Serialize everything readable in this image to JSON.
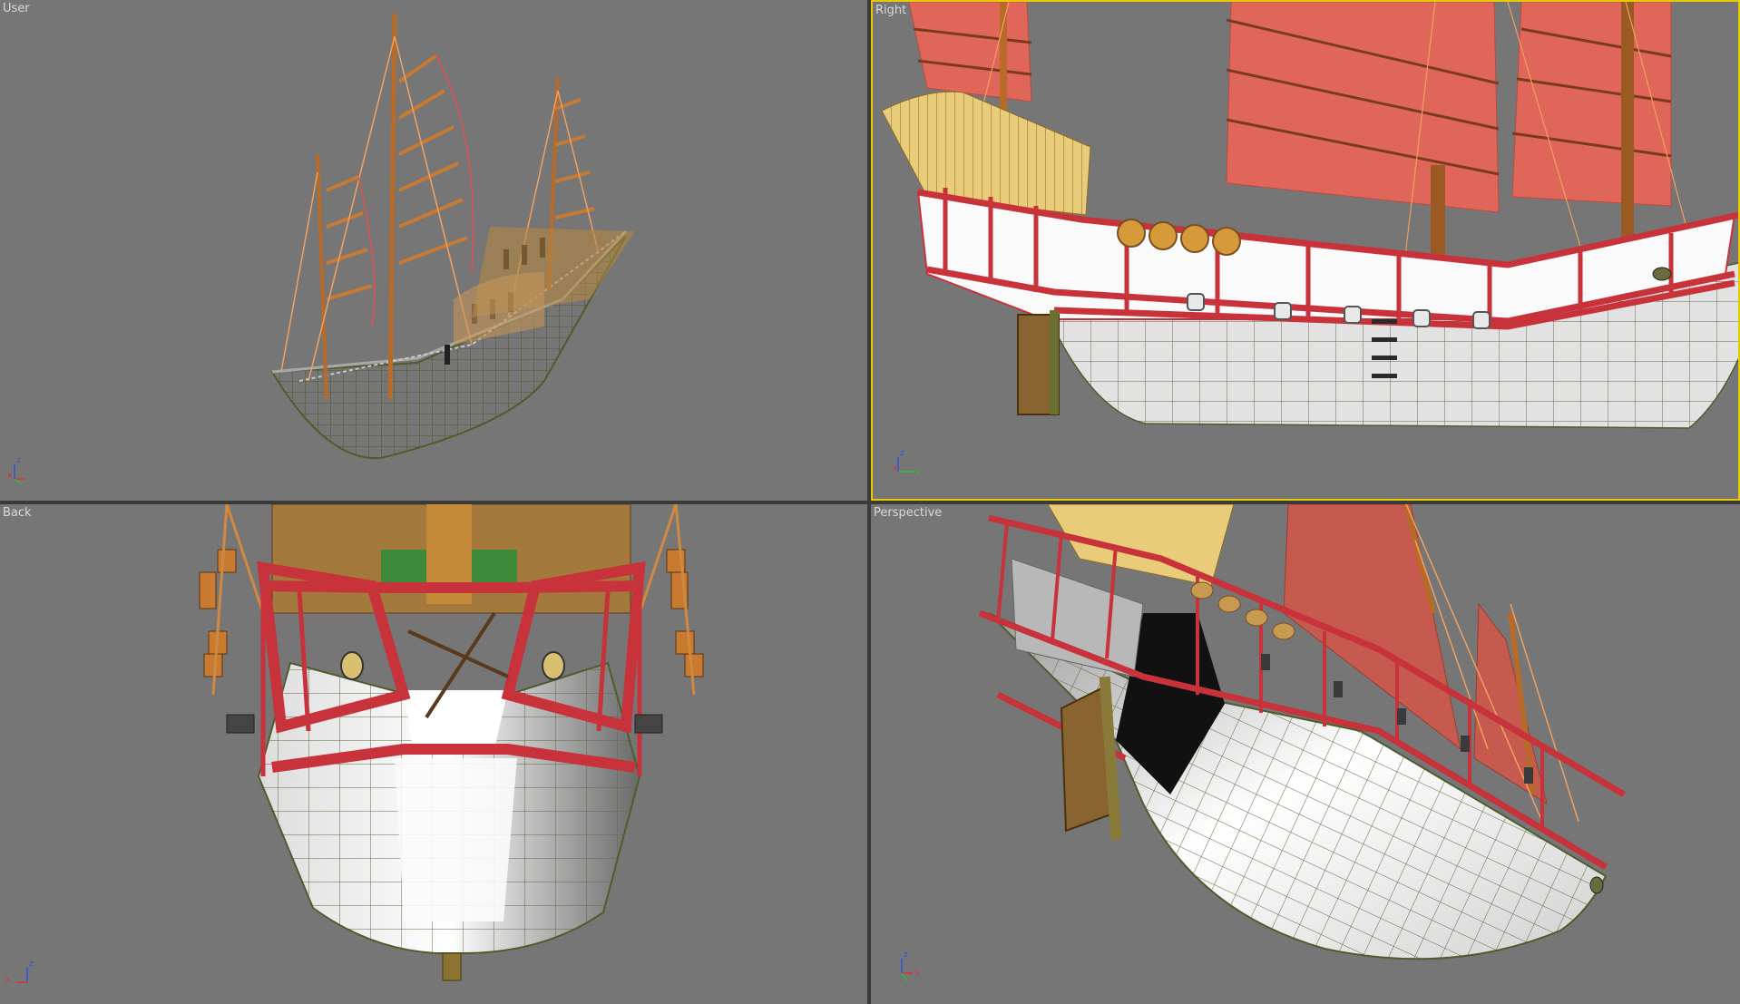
{
  "viewports": {
    "user": {
      "label": "User"
    },
    "right": {
      "label": "Right",
      "active": true
    },
    "back": {
      "label": "Back"
    },
    "perspective": {
      "label": "Perspective"
    }
  },
  "axes": {
    "x": "x",
    "y": "y",
    "z": "z"
  },
  "colors": {
    "viewport_bg": "#767676",
    "active_border": "#e8c800",
    "sail": "#e0665a",
    "hull": "#f4f4f4",
    "rail": "#c8323a",
    "mast": "#b86a28",
    "awning": "#e8cc7a"
  }
}
